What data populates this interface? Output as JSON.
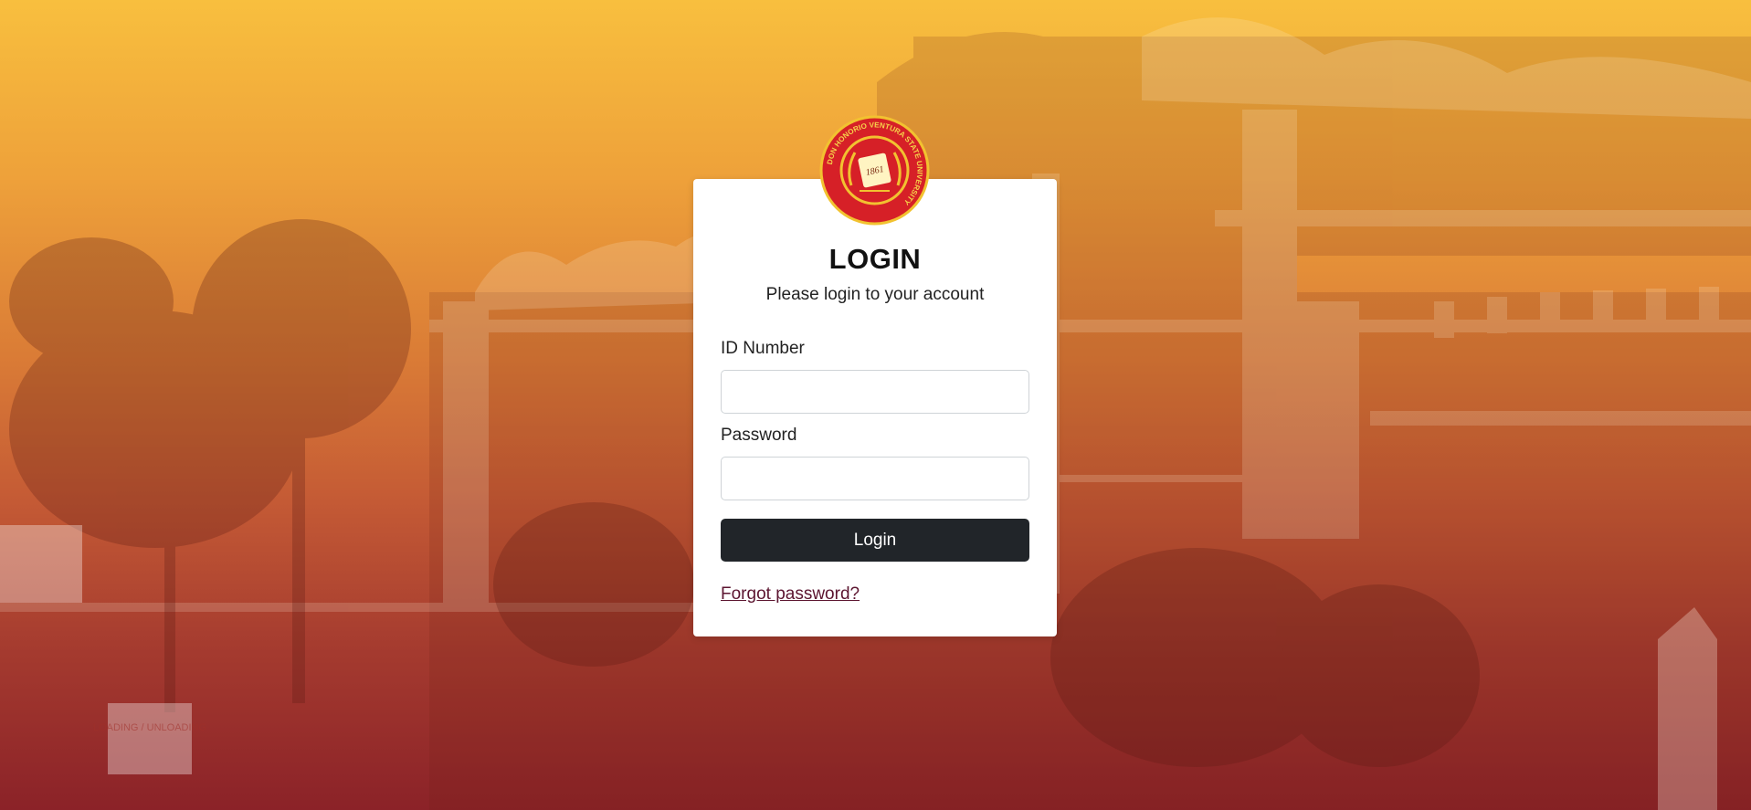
{
  "login": {
    "title": "LOGIN",
    "subtitle": "Please login to your account",
    "id_label": "ID Number",
    "id_value": "",
    "password_label": "Password",
    "password_value": "",
    "submit_label": "Login",
    "forgot_label": "Forgot password?"
  },
  "seal": {
    "ring_text": "DON HONORIO VENTURA STATE UNIVERSITY",
    "year": "1861",
    "icon": "university-seal-logo"
  },
  "background": {
    "sign_text": "LOADING / UNLOADING"
  },
  "colors": {
    "gradient_top": "#f8bf3e",
    "gradient_bottom": "#8b2228",
    "button": "#212529",
    "link": "#5c1530",
    "seal_red": "#d62027",
    "seal_gold": "#f2c230"
  }
}
